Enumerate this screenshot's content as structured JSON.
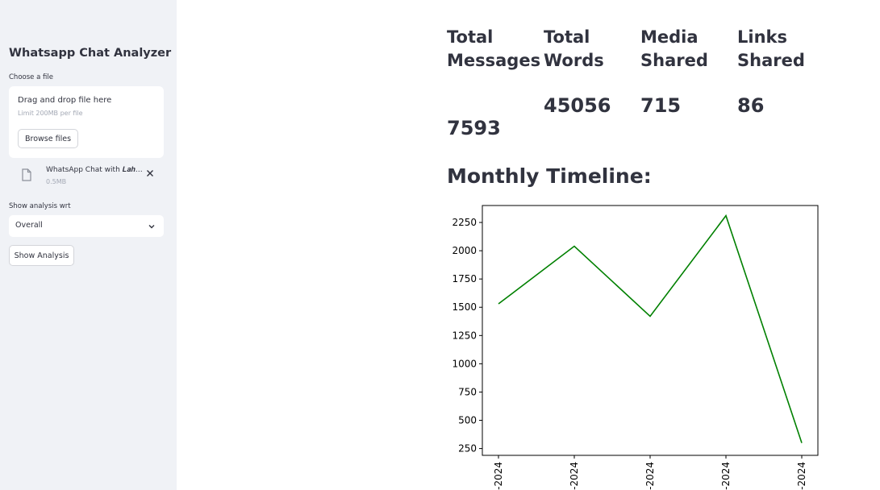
{
  "sidebar": {
    "title": "Whatsapp Chat Analyzer",
    "file_label": "Choose a file",
    "dropzone": {
      "main_text": "Drag and drop file here",
      "limit_text": "Limit 200MB per file",
      "browse_label": "Browse files"
    },
    "uploaded_file": {
      "icon": "file-icon",
      "name": "WhatsApp Chat with 𝑳𝒂𝒉…",
      "size": "0.5MB"
    },
    "analysis_label": "Show analysis wrt",
    "analysis_select": {
      "selected": "Overall"
    },
    "show_button_label": "Show Analysis"
  },
  "stats": [
    {
      "label_line1": "Total",
      "label_line2": "Messages",
      "value": "7593"
    },
    {
      "label_line1": "Total",
      "label_line2": "Words",
      "value": "45056"
    },
    {
      "label_line1": "Media",
      "label_line2": "Shared",
      "value": "715"
    },
    {
      "label_line1": "Links",
      "label_line2": "Shared",
      "value": "86"
    }
  ],
  "timeline_title": "Monthly Timeline:",
  "colors": {
    "line": "#008000",
    "sidebar_bg": "#f0f2f6",
    "text": "#31333f"
  },
  "chart_data": {
    "type": "line",
    "title": "",
    "xlabel": "",
    "ylabel": "",
    "x": [
      "-2024",
      "-2024",
      "-2024",
      "-2024",
      "-2024"
    ],
    "values": [
      1530,
      2040,
      1420,
      2310,
      300
    ],
    "ylim": [
      190,
      2400
    ],
    "yticks": [
      250,
      500,
      750,
      1000,
      1250,
      1500,
      1750,
      2000,
      2250
    ],
    "grid": false,
    "x_tick_rotation": "vertical"
  }
}
